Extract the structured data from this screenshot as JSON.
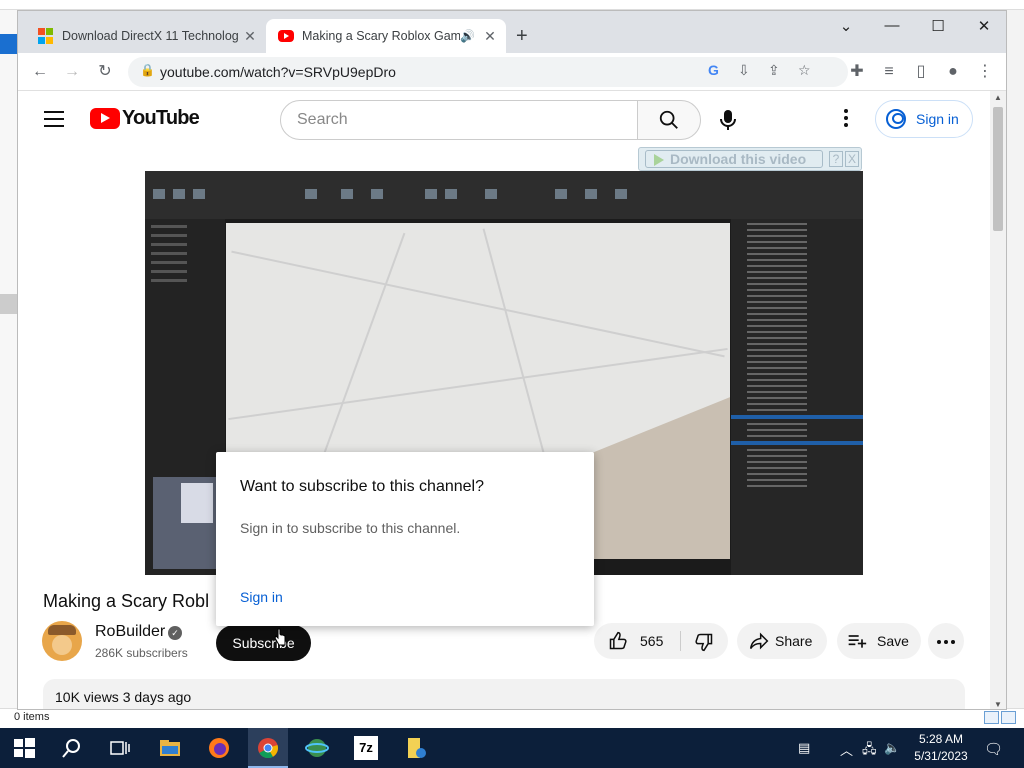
{
  "browser": {
    "tabs": [
      {
        "title": "Download DirectX 11 Technolog",
        "active": false
      },
      {
        "title": "Making a Scary Roblox Game",
        "active": true
      }
    ],
    "new_tab": "+",
    "url": "youtube.com/watch?v=SRVpU9epDro"
  },
  "youtube": {
    "logo_text": "YouTube",
    "search_placeholder": "Search",
    "sign_in_button": "Sign in",
    "download_bar": {
      "label": "Download this video",
      "help": "?",
      "close": "X"
    },
    "video_title": "Making a Scary Robl",
    "channel": {
      "name": "RoBuilder",
      "subscribers": "286K subscribers"
    },
    "subscribe_label": "Subscribe",
    "likes": "565",
    "share_label": "Share",
    "save_label": "Save",
    "meta": "10K views  3 days ago"
  },
  "popup": {
    "heading": "Want to subscribe to this channel?",
    "text": "Sign in to subscribe to this channel.",
    "sign_in": "Sign in"
  },
  "explorer": {
    "items": "0 items"
  },
  "taskbar": {
    "time": "5:28 AM",
    "date": "5/31/2023"
  },
  "colors": {
    "accent": "#065fd4",
    "youtube_red": "#ff0000",
    "taskbar": "#0c1f3a"
  }
}
